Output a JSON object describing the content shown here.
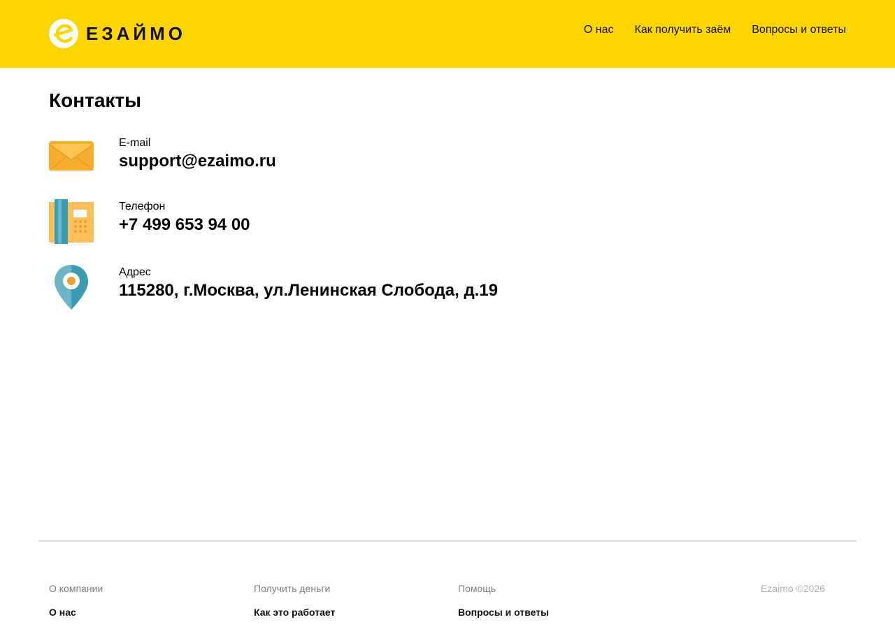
{
  "header": {
    "logo_text": "ЕЗАЙМО",
    "nav": [
      {
        "label": "О нас"
      },
      {
        "label": "Как получить заём"
      },
      {
        "label": "Вопросы и ответы"
      }
    ]
  },
  "main": {
    "title": "Контакты",
    "contacts": [
      {
        "icon": "envelope-icon",
        "label": "E-mail",
        "value": "support@ezaimo.ru"
      },
      {
        "icon": "phone-icon",
        "label": "Телефон",
        "value": "+7 499 653 94 00"
      },
      {
        "icon": "map-pin-icon",
        "label": "Адрес",
        "value": "115280, г.Москва, ул.Ленинская Слобода, д.19"
      }
    ]
  },
  "footer": {
    "columns": [
      {
        "heading": "О компании",
        "link": "О нас"
      },
      {
        "heading": "Получить деньги",
        "link": "Как это работает"
      },
      {
        "heading": "Помощь",
        "link": "Вопросы и ответы"
      }
    ],
    "copyright": "Ezaimo ©2026"
  },
  "colors": {
    "brand_yellow": "#FFD500",
    "envelope": "#F5AE2F",
    "phone_body": "#FFBE5A",
    "phone_stripe": "#3A9BB3",
    "pin": "#3A9BB3",
    "pin_dot": "#F39C2F"
  }
}
